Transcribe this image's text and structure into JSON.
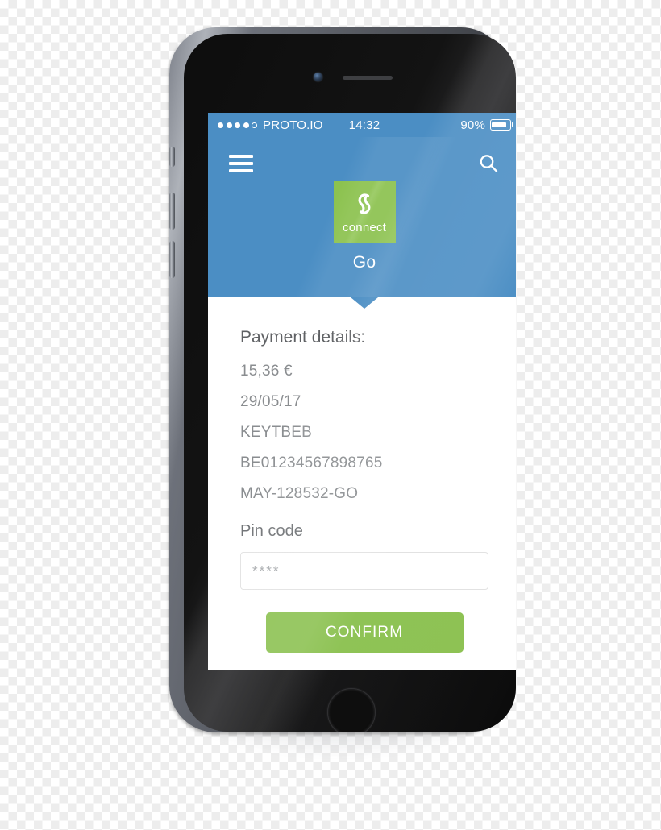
{
  "device": {
    "name": "smartphone-mockup",
    "hardware": {
      "camera": "front-camera",
      "speaker": "earpiece-speaker",
      "home_button": "home-button"
    }
  },
  "status_bar": {
    "signal_dots_filled": 4,
    "signal_dots_total": 5,
    "carrier": "PROTO.IO",
    "time": "14:32",
    "battery_percent": "90%",
    "battery_icon": "battery-icon"
  },
  "nav": {
    "menu_icon": "hamburger-menu-icon",
    "search_icon": "search-icon"
  },
  "header": {
    "logo": {
      "icon": "connect-link-icon",
      "word": "connect"
    },
    "title": "Go"
  },
  "payment": {
    "section_title": "Payment details:",
    "details": [
      "15,36 €",
      "29/05/17",
      "KEYTBEB",
      "BE01234567898765",
      "MAY-128532-GO"
    ],
    "pin": {
      "label": "Pin code",
      "value": "****",
      "placeholder": "****"
    },
    "confirm_label": "CONFIRM"
  },
  "colors": {
    "header_blue": "#4b8ec4",
    "brand_green": "#8dc253",
    "text_gray": "#8a8d90",
    "white": "#ffffff"
  }
}
